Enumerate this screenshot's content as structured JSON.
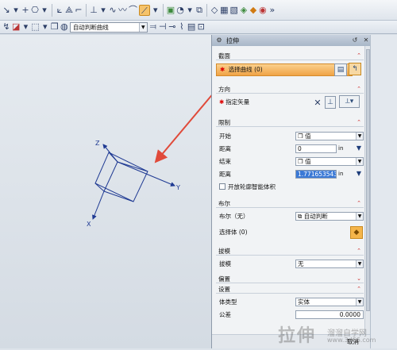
{
  "toolbar": {
    "filter_combo": "自动判断曲线"
  },
  "dialog": {
    "title": "拉伸",
    "sections": {
      "section": "截面",
      "direction": "方向",
      "limits": "限制",
      "boolean": "布尔",
      "draft": "拔模",
      "offset": "偏置",
      "settings": "设置"
    },
    "select_curve": "选择曲线 (0)",
    "specify_vector": "指定矢量",
    "start_label": "开始",
    "start_type": "值",
    "start_distance_label": "距离",
    "start_distance": "0",
    "end_label": "结束",
    "end_type": "值",
    "end_distance_label": "距离",
    "end_distance": "1.771653543",
    "unit": "in",
    "open_profile_smart_volume": "开放轮廓智能体积",
    "boolean_label": "布尔（无）",
    "boolean_value": "自动判断",
    "select_body": "选择体 (0)",
    "draft_label": "拔模",
    "draft_value": "无",
    "body_type_label": "体类型",
    "body_type_value": "实体",
    "tolerance_label": "公差",
    "tolerance_value": "0.0000",
    "cancel": "取消"
  },
  "axes": {
    "x": "X",
    "y": "Y",
    "z": "Z"
  },
  "watermark": {
    "line1": "拉伸",
    "line2": "溜溜自学网",
    "line3": "www.3d66.com"
  },
  "colors": {
    "highlight": "#f0a346",
    "axis": "#1f3a93",
    "arrow": "#e04a3a"
  }
}
